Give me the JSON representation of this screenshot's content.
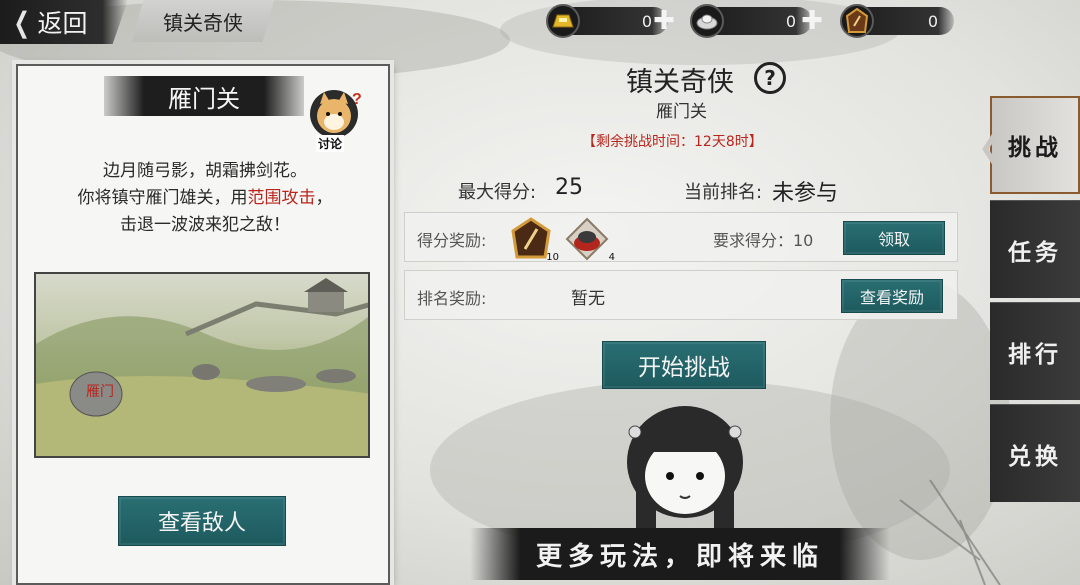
{
  "header": {
    "back_label": "返回",
    "page_tab": "镇关奇侠"
  },
  "currencies": [
    {
      "icon": "gold-ingot-icon",
      "value": "0"
    },
    {
      "icon": "silver-ingot-icon",
      "value": "0"
    },
    {
      "icon": "token-badge-icon",
      "value": "0"
    }
  ],
  "side_tabs": [
    "挑战",
    "任务",
    "排行",
    "兑换"
  ],
  "card": {
    "title": "雁门关",
    "discuss_label": "讨论",
    "desc_line1": "边月随弓影，胡霜拂剑花。",
    "desc_line2_pre": "你将镇守雁门雄关，用",
    "desc_line2_hl": "范围攻击",
    "desc_line2_post": "，",
    "desc_line3": "击退一波波来犯之敌！",
    "scene_sign": "雁门",
    "enemy_button": "查看敌人"
  },
  "main": {
    "title": "镇关奇侠",
    "subtitle": "雁门关",
    "remaining": "【剩余挑战时间：12天8时】",
    "max_score_label": "最大得分:",
    "max_score_value": "25",
    "rank_label": "当前排名:",
    "rank_value": "未参与",
    "score_reward_label": "得分奖励:",
    "score_reward_items": [
      {
        "icon": "token-badge-icon",
        "count": "10"
      },
      {
        "icon": "treasure-bowl-icon",
        "count": "4"
      }
    ],
    "required_score_label": "要求得分：10",
    "claim_button": "领取",
    "rank_reward_label": "排名奖励:",
    "rank_reward_value": "暂无",
    "view_rewards_button": "查看奖励",
    "start_button": "开始挑战",
    "banner_text": "更多玩法，即将来临"
  },
  "colors": {
    "accent_teal": "#1d5a5e",
    "highlight_red": "#b8261e",
    "dark_ink": "#1b1b1b"
  }
}
